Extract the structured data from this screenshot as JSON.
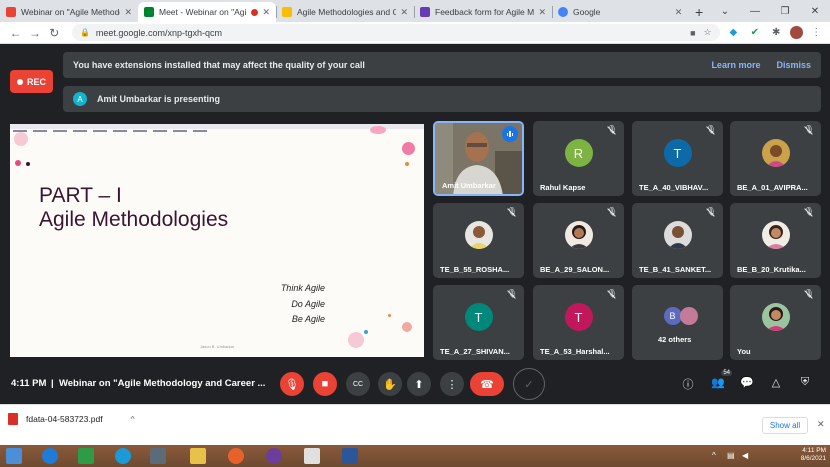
{
  "tabs": [
    {
      "title": "Webinar on \"Agile Methodologies\"",
      "favicon_color": "#ea4335"
    },
    {
      "title": "Meet - Webinar on \"Agile",
      "favicon_color": "#00832d"
    },
    {
      "title": "Agile Methodologies and Career",
      "favicon_color": "#fbbc04"
    },
    {
      "title": "Feedback form for Agile Meth",
      "favicon_color": "#673ab7"
    },
    {
      "title": "Google",
      "favicon_color": "#4285f4"
    }
  ],
  "address": {
    "url": "meet.google.com/xnp-tgxh-qcm"
  },
  "rec_label": "REC",
  "banner": {
    "message": "You have extensions installed that may affect the quality of your call",
    "learn_more": "Learn more",
    "dismiss": "Dismiss"
  },
  "presenting": {
    "initial": "A",
    "text": "Amit Umbarkar is presenting"
  },
  "slide": {
    "title_line1": "PART – I",
    "title_line2": "Agile Methodologies",
    "line1": "Think Agile",
    "line2": "Do Agile",
    "line3": "Be Agile",
    "footer": "Jason B. Umbarkar"
  },
  "participants": [
    {
      "name": "Amit Umbarkar",
      "type": "presenter"
    },
    {
      "name": "Rahul Kapse",
      "initial": "R",
      "color": "#7cb342"
    },
    {
      "name": "TE_A_40_VIBHAV...",
      "initial": "T",
      "color": "#0d6aa8"
    },
    {
      "name": "BE_A_01_AVIPRA...",
      "type": "photo"
    },
    {
      "name": "TE_B_55_ROSHA...",
      "type": "photo"
    },
    {
      "name": "BE_A_29_SALON...",
      "type": "photo"
    },
    {
      "name": "TE_B_41_SANKET...",
      "type": "photo"
    },
    {
      "name": "BE_B_20_Krutika...",
      "type": "photo"
    },
    {
      "name": "TE_A_27_SHIVAN...",
      "initial": "T",
      "color": "#00897b"
    },
    {
      "name": "TE_A_53_Harshal...",
      "initial": "T",
      "color": "#c2185b"
    },
    {
      "name": "42 others",
      "initial": "B",
      "color": "#5c6bc0"
    },
    {
      "name": "You",
      "type": "photo"
    }
  ],
  "controls": {
    "time": "4:11 PM",
    "separator": "|",
    "meeting_title": "Webinar on \"Agile Methodology and Career ...",
    "people_count": "54"
  },
  "download": {
    "filename": "fdata-04-583723.pdf",
    "show_all": "Show all"
  },
  "taskbar": {
    "time": "4:11 PM",
    "date": "8/6/2021"
  }
}
